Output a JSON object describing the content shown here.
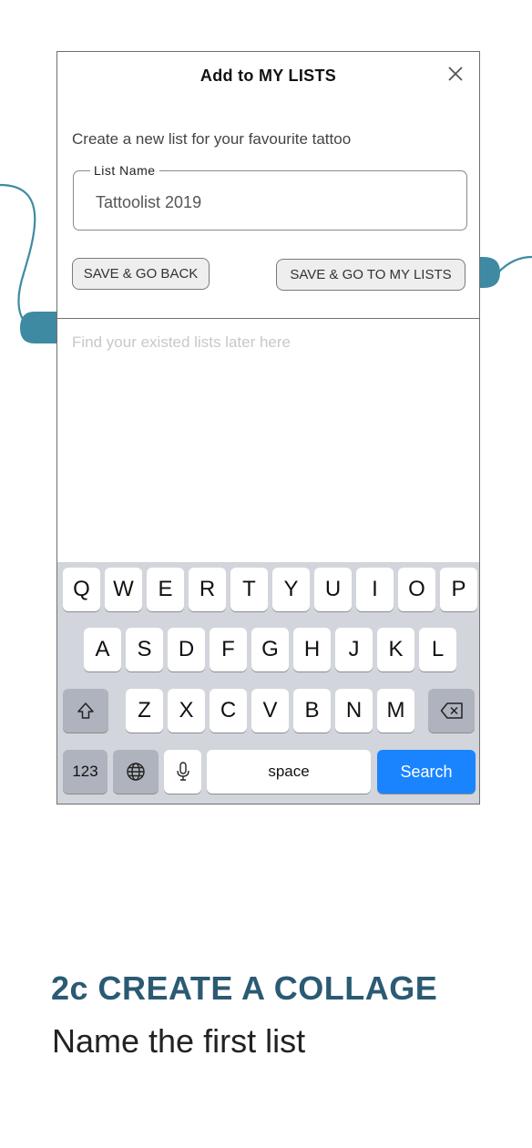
{
  "dialog": {
    "title": "Add to MY LISTS",
    "subtitle": "Create a new list for your favourite tattoo",
    "field_label": "List Name",
    "field_value": "Tattoolist 2019",
    "btn_back": "SAVE & GO BACK",
    "btn_mylists": "SAVE & GO TO MY LISTS",
    "hint": "Find your existed lists later here"
  },
  "keyboard": {
    "row1": [
      "Q",
      "W",
      "E",
      "R",
      "T",
      "Y",
      "U",
      "I",
      "O",
      "P"
    ],
    "row2": [
      "A",
      "S",
      "D",
      "F",
      "G",
      "H",
      "J",
      "K",
      "L"
    ],
    "row3": [
      "Z",
      "X",
      "C",
      "V",
      "B",
      "N",
      "M"
    ],
    "numbers": "123",
    "space": "space",
    "search": "Search"
  },
  "caption": {
    "heading": "2c CREATE A COLLAGE",
    "sub": "Name the first list"
  },
  "colors": {
    "accent": "#2b5a73",
    "connector": "#3f8aa3",
    "search_key": "#1a84ff",
    "keyboard_bg": "#d2d5db"
  },
  "icons": [
    "close-icon",
    "shift-icon",
    "backspace-icon",
    "globe-icon",
    "microphone-icon"
  ]
}
